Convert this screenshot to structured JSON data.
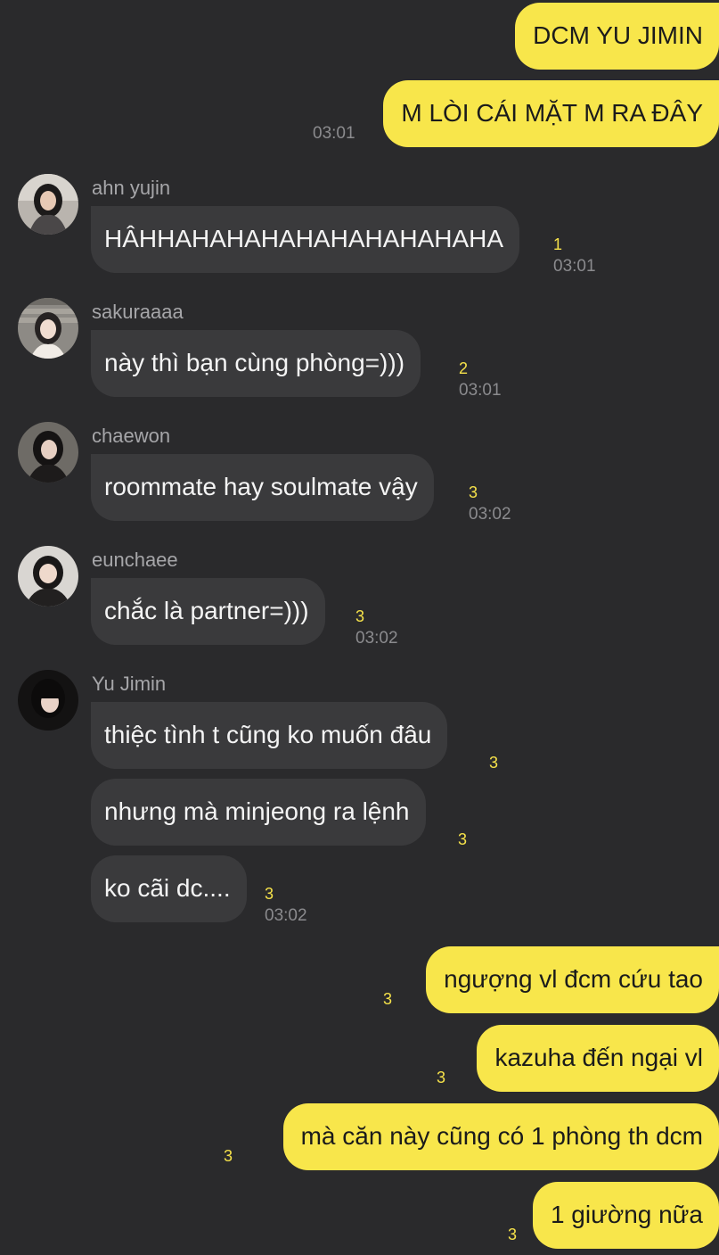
{
  "messages": {
    "m1": {
      "text": "DCM YU JIMIN"
    },
    "m2": {
      "text": "M LÒI CÁI MẶT M RA ĐÂY",
      "time": "03:01"
    },
    "ahn": {
      "sender": "ahn yujin",
      "text": "HÂHHAHAHAHAHAHAHAHAHAHA",
      "count": "1",
      "time": "03:01"
    },
    "sakura": {
      "sender": "sakuraaaa",
      "text": "này thì bạn cùng phòng=)))",
      "count": "2",
      "time": "03:01"
    },
    "chaewon": {
      "sender": "chaewon",
      "text": "roommate hay soulmate vậy",
      "count": "3",
      "time": "03:02"
    },
    "eunchae": {
      "sender": "eunchaee",
      "text": "chắc là partner=)))",
      "count": "3",
      "time": "03:02"
    },
    "jimin": {
      "sender": "Yu Jimin",
      "lines": [
        {
          "text": "thiệc tình t cũng ko muốn đâu",
          "count": "3"
        },
        {
          "text": "nhưng mà minjeong ra lệnh",
          "count": "3"
        },
        {
          "text": "ko cãi dc....",
          "count": "3",
          "time": "03:02"
        }
      ]
    },
    "mine2": [
      {
        "text": "ngượng vl đcm cứu tao",
        "count": "3"
      },
      {
        "text": "kazuha đến ngại vl",
        "count": "3"
      },
      {
        "text": "mà căn này cũng có 1 phòng th dcm",
        "count": "3"
      },
      {
        "text": "1 giường nữa",
        "count": "3"
      }
    ]
  },
  "colors": {
    "background": "#2a2a2c",
    "my_bubble": "#f8e64b",
    "other_bubble": "#3a3a3c",
    "unread_count": "#f6e24a"
  }
}
